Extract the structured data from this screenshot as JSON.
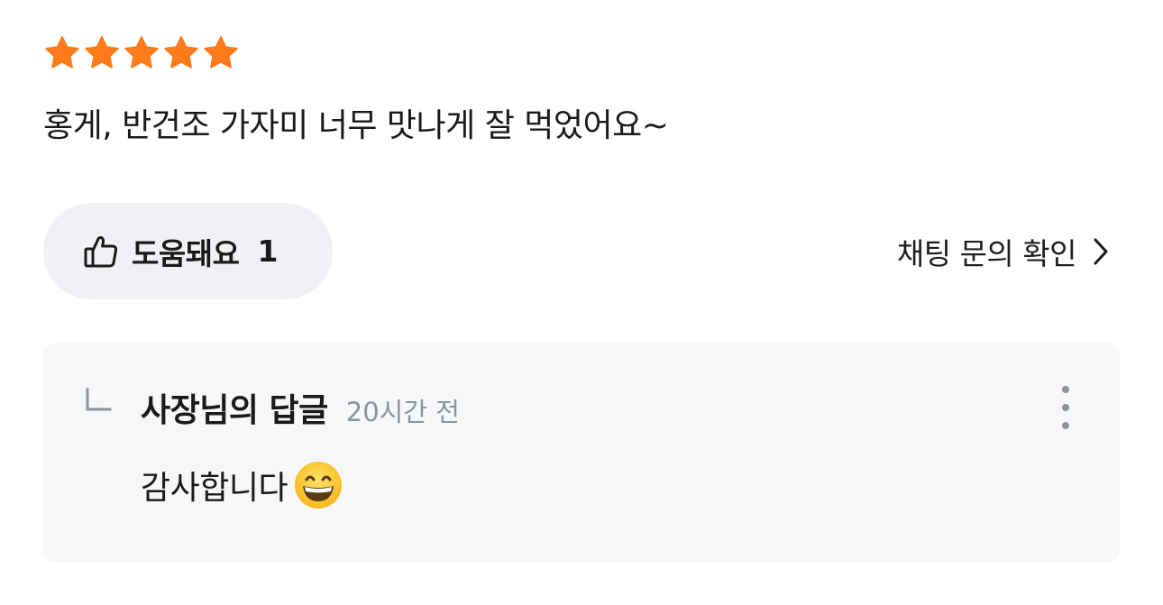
{
  "review": {
    "rating": 5,
    "rating_max": 5,
    "star_color": "#ff7a1a",
    "text": "홍게, 반건조 가자미 너무 맛나게 잘 먹었어요~"
  },
  "actions": {
    "helpful_label": "도움돼요",
    "helpful_count": "1",
    "helpful_icon": "thumbs-up-icon",
    "chat_label": "채팅 문의 확인",
    "chat_icon": "chevron-right-icon"
  },
  "reply": {
    "author": "사장님의 답글",
    "time": "20시간 전",
    "text": "감사합니다",
    "emoji": "grinning-face-with-smiling-eyes",
    "more_icon": "more-vertical-icon",
    "corner_icon": "reply-corner-icon"
  }
}
